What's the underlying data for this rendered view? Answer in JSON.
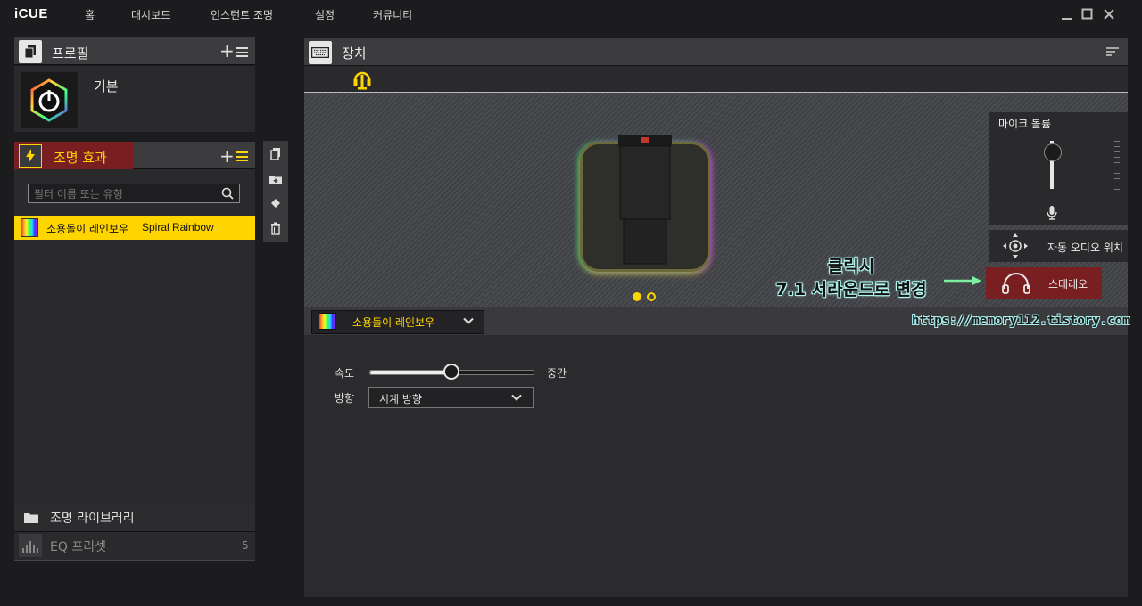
{
  "app": {
    "name": "iCUE"
  },
  "nav": [
    "홈",
    "대시보드",
    "인스턴트 조명",
    "설정",
    "커뮤니티"
  ],
  "profile": {
    "header": "프로필",
    "name": "기본"
  },
  "lighting": {
    "header": "조명 효과",
    "filter_placeholder": "필터 이름 또는 유형",
    "effects": [
      {
        "name_ko": "소용돌이 레인보우",
        "name_en": "Spiral Rainbow"
      }
    ]
  },
  "library": {
    "label": "조명 라이브러리"
  },
  "eq": {
    "label": "EQ 프리셋",
    "count": "5"
  },
  "devices": {
    "header": "장치"
  },
  "mic": {
    "label": "마이크 볼륨",
    "level": 0.85
  },
  "audio": {
    "auto_position": "자동 오디오 위치",
    "stereo": "스테레오"
  },
  "annotation": {
    "line1": "클릭시",
    "line2": "7.1 서라운드로 변경"
  },
  "watermark": "https://memory112.tistory.com",
  "effect_editor": {
    "selected": "소용돌이 레인보우",
    "speed_label": "속도",
    "speed_value_label": "중간",
    "speed_level": 0.5,
    "direction_label": "방향",
    "direction_value": "시계 방향"
  },
  "pager": {
    "pages": 2,
    "current": 1
  },
  "colors": {
    "accent": "#ffd500",
    "stereo_bg": "#7a1f21",
    "lighting_header_bg": "#7a1f21"
  }
}
